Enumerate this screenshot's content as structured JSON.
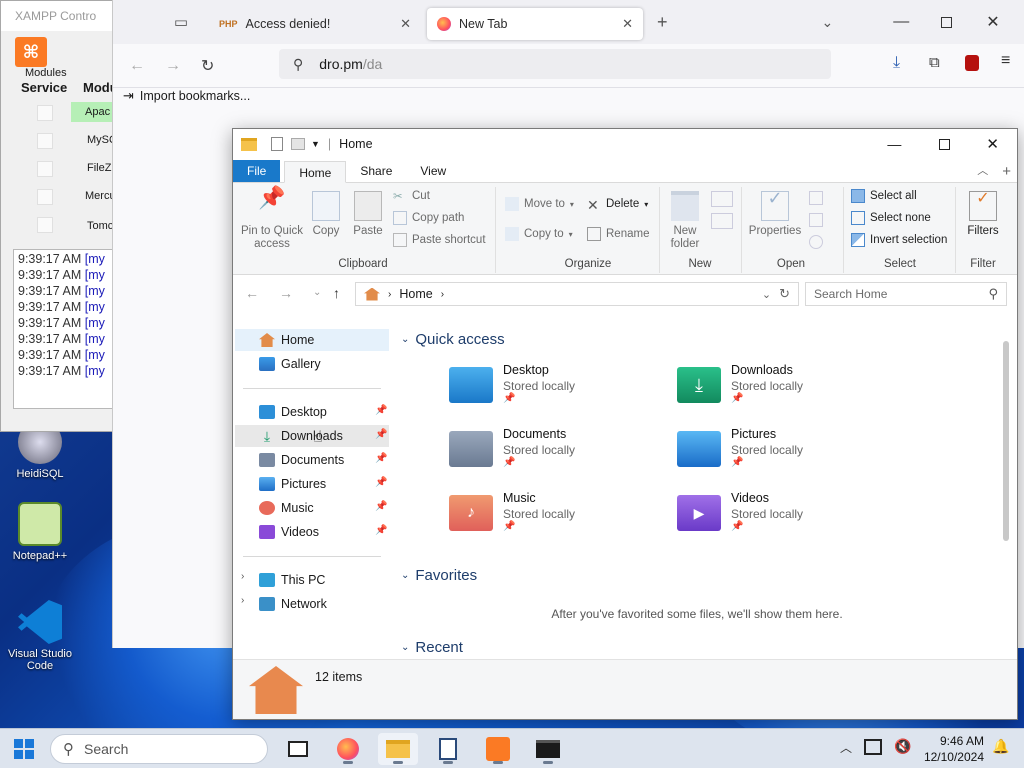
{
  "xampp": {
    "title": "XAMPP Contro",
    "modules_label": "Modules",
    "service_header": "Service",
    "module_header": "Modu",
    "modules": [
      "Apac",
      "MySQ",
      "FileZi",
      "Mercu",
      "Tomc"
    ],
    "log": [
      {
        "time": "9:39:17 AM",
        "msg": "[my"
      },
      {
        "time": "9:39:17 AM",
        "msg": "[my"
      },
      {
        "time": "9:39:17 AM",
        "msg": "[my"
      },
      {
        "time": "9:39:17 AM",
        "msg": "[my"
      },
      {
        "time": "9:39:17 AM",
        "msg": "[my"
      },
      {
        "time": "9:39:17 AM",
        "msg": "[my"
      },
      {
        "time": "9:39:17 AM",
        "msg": "[my"
      },
      {
        "time": "9:39:17 AM",
        "msg": "[my"
      }
    ]
  },
  "desktop": {
    "icons": [
      {
        "label": "HeidiSQL"
      },
      {
        "label": "Notepad++"
      },
      {
        "label": "Visual Studio Code"
      }
    ]
  },
  "browser": {
    "tabs": [
      {
        "label": "Access denied!"
      },
      {
        "label": "New Tab"
      }
    ],
    "url_host": "dro.pm",
    "url_path": "/da",
    "bookmarks_import": "Import bookmarks..."
  },
  "explorer": {
    "title": "Home",
    "ribbon_tabs": {
      "file": "File",
      "home": "Home",
      "share": "Share",
      "view": "View"
    },
    "ribbon": {
      "pin": "Pin to Quick access",
      "copy": "Copy",
      "paste": "Paste",
      "cut": "Cut",
      "copy_path": "Copy path",
      "paste_shortcut": "Paste shortcut",
      "clipboard": "Clipboard",
      "move_to": "Move to",
      "copy_to": "Copy to",
      "delete": "Delete",
      "rename": "Rename",
      "organize": "Organize",
      "new_folder": "New folder",
      "new": "New",
      "properties": "Properties",
      "open": "Open",
      "select_all": "Select all",
      "select_none": "Select none",
      "invert_selection": "Invert selection",
      "select": "Select",
      "filters": "Filters",
      "filter": "Filter"
    },
    "address": "Home",
    "search_placeholder": "Search Home",
    "nav": {
      "home": "Home",
      "gallery": "Gallery",
      "desktop": "Desktop",
      "downloads": "Downloads",
      "documents": "Documents",
      "pictures": "Pictures",
      "music": "Music",
      "videos": "Videos",
      "this_pc": "This PC",
      "network": "Network"
    },
    "quick_access_title": "Quick access",
    "quick_access": [
      {
        "name": "Desktop",
        "sub": "Stored locally"
      },
      {
        "name": "Downloads",
        "sub": "Stored locally"
      },
      {
        "name": "Documents",
        "sub": "Stored locally"
      },
      {
        "name": "Pictures",
        "sub": "Stored locally"
      },
      {
        "name": "Music",
        "sub": "Stored locally"
      },
      {
        "name": "Videos",
        "sub": "Stored locally"
      }
    ],
    "favorites_title": "Favorites",
    "favorites_empty": "After you've favorited some files, we'll show them here.",
    "recent_title": "Recent",
    "status": "12 items"
  },
  "taskbar": {
    "search_placeholder": "Search",
    "time": "9:46 AM",
    "date": "12/10/2024"
  },
  "colors": {
    "accent": "#1979ca",
    "xampp_orange": "#fb7a24",
    "section_heading": "#1e3d6b"
  }
}
